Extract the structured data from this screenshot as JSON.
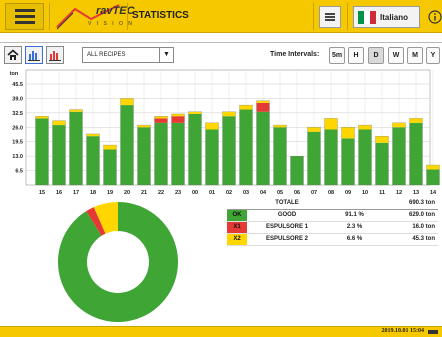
{
  "header": {
    "brand": "ravTEC",
    "brand_sub": "V I S I O N",
    "title": "STATISTICS",
    "language": "Italiano",
    "flag_colors": [
      "#009246",
      "#ffffff",
      "#ce2b37"
    ]
  },
  "toolbar": {
    "recipe_selected": "ALL RECIPES",
    "time_intervals_label": "Time Intervals:",
    "intervals": [
      "5m",
      "H",
      "D",
      "W",
      "M",
      "Y"
    ],
    "active_interval": "D"
  },
  "colors": {
    "ok": "#3fa535",
    "x1": "#e53935",
    "x2": "#ffd600",
    "accent": "#f5c800"
  },
  "chart_data": {
    "type": "bar",
    "stacked": true,
    "ylabel": "ton",
    "ylim": [
      0,
      45.5
    ],
    "yticks": [
      6.5,
      13.0,
      19.5,
      26.0,
      32.5,
      39.0,
      45.5
    ],
    "ytick_labels": [
      "6.5",
      "13.0",
      "19.5",
      "26.0",
      "32.5",
      "39.0",
      "45.5"
    ],
    "grid": true,
    "categories": [
      "15",
      "16",
      "17",
      "18",
      "19",
      "20",
      "21",
      "22",
      "23",
      "00",
      "01",
      "02",
      "03",
      "04",
      "05",
      "06",
      "07",
      "08",
      "09",
      "10",
      "11",
      "12",
      "13",
      "14",
      "15"
    ],
    "series": [
      {
        "name": "GOOD",
        "color": "#3fa535",
        "values": [
          30,
          27,
          33,
          22,
          16,
          36,
          26,
          28,
          28,
          32,
          25,
          31,
          34,
          33,
          26,
          13,
          24,
          25,
          21,
          25,
          19,
          26,
          28,
          7,
          0
        ]
      },
      {
        "name": "ESPULSORE 1",
        "color": "#e53935",
        "values": [
          0,
          0,
          0,
          0,
          0,
          0,
          0,
          2,
          3,
          0,
          0,
          0,
          0,
          4,
          0,
          0,
          0,
          0,
          0,
          0,
          0,
          0,
          0,
          0,
          0
        ]
      },
      {
        "name": "ESPULSORE 2",
        "color": "#ffd600",
        "values": [
          1,
          2,
          1,
          1,
          2,
          3,
          1,
          1,
          1,
          1,
          3,
          2,
          2,
          1,
          1,
          0,
          2,
          5,
          5,
          2,
          3,
          2,
          2,
          2,
          0
        ]
      }
    ]
  },
  "summary": {
    "total_label": "TOTALE",
    "total_value": "690.3 ton",
    "rows": [
      {
        "code": "OK",
        "name": "GOOD",
        "percent": "91.1 %",
        "value": "629.0 ton",
        "color": "#3fa535"
      },
      {
        "code": "X1",
        "name": "ESPULSORE 1",
        "percent": "2.3 %",
        "value": "16.0 ton",
        "color": "#e53935"
      },
      {
        "code": "X2",
        "name": "ESPULSORE 2",
        "percent": "6.6 %",
        "value": "45.3 ton",
        "color": "#ffd600"
      }
    ],
    "donut_fractions": [
      0.911,
      0.023,
      0.066
    ]
  },
  "footer": {
    "timestamp": "2019.10.01 15:04"
  }
}
